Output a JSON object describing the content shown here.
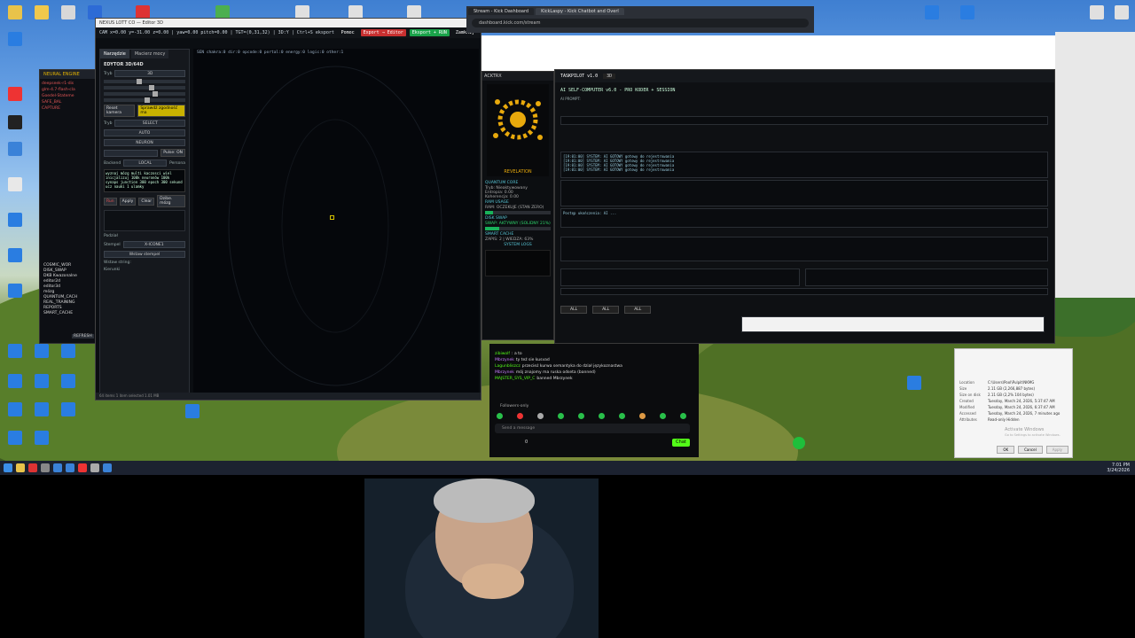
{
  "taskbar": {
    "clock_time": "7:01 PM",
    "clock_date": "3/24/2026"
  },
  "editor": {
    "title": "NEXUS LOTT CO — Editor 3D",
    "coords": "CAM x=0.00 y=-31.00 z=0.00 | yaw=0.00 pitch=0.00 | TGT=(0,31,32) | 3D:Y | Ctrl+S eksport",
    "btn_help": "Pomoc",
    "btn_export_editor": "Export → Editor",
    "btn_export_run": "Eksport + RUN",
    "btn_close": "Zamknij",
    "tabs": [
      "Narzędzie",
      "Macierz mocy"
    ],
    "panel_title": "EDYTOR 3D/64D",
    "mode_label": "Tryb",
    "mode_value": "3D",
    "reset_camera": "Reset kamera",
    "check_consistency": "Sprawdź zgodność ma",
    "select_label": "Tryb",
    "select_value": "SELECT",
    "auto_value": "AUTO",
    "neuron_value": "NEURON",
    "pulse_label": "Pulse: ON",
    "backend_label": "Backend",
    "backend_value": "LOCAL",
    "persona_label": "Persona",
    "code_text": "wyznaj mózg multi kaczosci wiel inicjalizuj 100k neuronów 100k synaps junction 300 epoch 300 sekund ucz nauki 1 ulamky",
    "btn_run": "Run",
    "btn_apply": "Apply",
    "btn_clear": "Clear",
    "btn_mind": "Dzibe. mózg",
    "param_label": "Podział",
    "stamp_label": "Stempel",
    "stamp_value": "X-ICONE1",
    "insert_stamp": "Wstaw stempel",
    "stamp_string": "Wstaw string:",
    "direction_label": "Kierunki",
    "canvas_status": "SEN  chakra:0  dir:0  opcode:0  portal:0  energy:0  logic:0  other:1",
    "statusbar": "64 items  1 item selected  1.01 MB"
  },
  "neural": {
    "title": "NEURAL ENGINE",
    "lines": [
      "deepseek-r1-dis",
      "glm-4.7-flash-cla",
      "Goedel-Stateme",
      "SAFE_BAL",
      "CAPTURE"
    ],
    "tree": [
      "COSMIC_WOR",
      "DISK_SWAP",
      "DKB Kwazonalne",
      "editor2d",
      "editor3d",
      "mózg",
      "QUANTUM_CACH",
      "REAL_TRAINING",
      "REPORTS",
      "SMART_CACHE"
    ],
    "refresh": "REFRESH"
  },
  "browser": {
    "tabs": [
      "Stream - Kick Dashboard",
      "KickLaspy - Kick Chatbot and Overl"
    ],
    "url": "dashboard.kick.com/stream"
  },
  "quantum": {
    "head": "ACKTRX",
    "brand": "REVELATION",
    "core": "QUANTUM CORE",
    "core_status": "Tryb: Nieaktywowany",
    "entropy": "Entropia: 0.00",
    "coherence": "Koherencja: 0.00",
    "ram": "RAM USAGE",
    "ram_state": "RAM: OCZEKUJE (STAN ZERO)",
    "disk": "DISK SWAP",
    "disk_state": "SWAP: AKTYWNY (SOLIDNY 21%)",
    "ram_fill": 0.12,
    "disk_fill": 0.21,
    "cache": "SMART CACHE",
    "cache_state": "ZAPIS: 2 | WIEDZA: 63%",
    "logs": "SYSTEM LOGS"
  },
  "taskpilot": {
    "title": "TASKPILOT v1.0",
    "mode": "3D",
    "header": "AI SELF-COMPUTER v6.0 - PRO KODER + SESSION",
    "prompt_label": "AI PROMPT:",
    "log_lines": [
      "[19:01:00] SYSTEM: AI GOTOWY gotowy do rejestrowania",
      "[19:01:00] SYSTEM: AI GOTOWY gotowy do rejestrowania",
      "[19:01:00] SYSTEM: AI GOTOWY gotowy do rejestrowania",
      "[19:01:00] SYSTEM: AI GOTOWY gotowy do rejestrowania"
    ],
    "filters": [
      "ALL",
      "ALL",
      "ALL"
    ],
    "plan_text": "Postęp ukończenia: AI ..."
  },
  "chat": {
    "lines": [
      {
        "user": "zibiwolf",
        "text": ": a to"
      },
      {
        "user": "Mbrzynek",
        "text": "ty teź sie kusvad"
      },
      {
        "user": "Lagunbliszcz",
        "text": "przecież kurwa semantyka do dział językoznastwa"
      },
      {
        "user": "Mbrzynek",
        "text": "mój znajomy ma ruska odseta (banned)"
      },
      {
        "user": "MAJSTER_SYS_VIP_C",
        "text": "banned Mbrzynek"
      }
    ],
    "followers_only": "Followers-only",
    "placeholder": "Send a message",
    "send": "Chat",
    "count": "0"
  },
  "props": {
    "rows": [
      {
        "k": "Location",
        "v": "C:\\Users\\Pool\\Pulpit\\NKMG"
      },
      {
        "k": "Size",
        "v": "2.11 GB (2,266,887 bytes)"
      },
      {
        "k": "Size on disk",
        "v": "2.11 GB (2,2% 104 bytes)"
      },
      {
        "k": "Created",
        "v": "Tuesday, March 24, 2026, 5:37:47 AM"
      },
      {
        "k": "Modified",
        "v": "Tuesday, March 24, 2026, 6:37:47 AM"
      },
      {
        "k": "Accessed",
        "v": "Tuesday, March 24, 2026, 7 minutes ago"
      },
      {
        "k": "Attributes",
        "v": "Read-only  Hidden"
      }
    ],
    "activate": "Activate Windows",
    "activate_sub": "Go to Settings to activate Windows.",
    "ok": "OK",
    "cancel": "Cancel",
    "apply": "Apply"
  },
  "colors": {
    "kick_green": "#53fc18",
    "accent_yellow": "#d4c200",
    "export_green": "#1aa34a"
  }
}
